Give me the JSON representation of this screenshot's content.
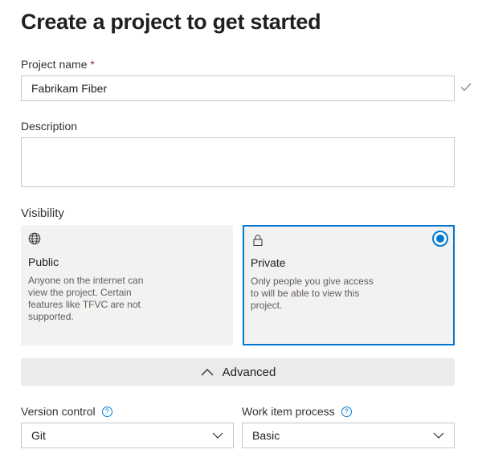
{
  "page": {
    "title": "Create a project to get started"
  },
  "project_name": {
    "label": "Project name",
    "required_marker": "*",
    "value": "Fabrikam Fiber"
  },
  "description": {
    "label": "Description",
    "value": ""
  },
  "visibility": {
    "label": "Visibility",
    "selected": "Private",
    "options": [
      {
        "title": "Public",
        "icon": "globe-icon",
        "description": "Anyone on the internet can view the project. Certain features like TFVC are not supported."
      },
      {
        "title": "Private",
        "icon": "lock-icon",
        "description": "Only people you give access to will be able to view this project."
      }
    ]
  },
  "advanced": {
    "label": "Advanced",
    "expanded": true
  },
  "version_control": {
    "label": "Version control",
    "help": "?",
    "value": "Git"
  },
  "work_item_process": {
    "label": "Work item process",
    "help": "?",
    "value": "Basic"
  },
  "colors": {
    "accent": "#0078d4",
    "valid_check": "#8a8886",
    "card_bg": "#f3f2f1",
    "advanced_bg": "#edebe9",
    "required": "#a4262c"
  }
}
